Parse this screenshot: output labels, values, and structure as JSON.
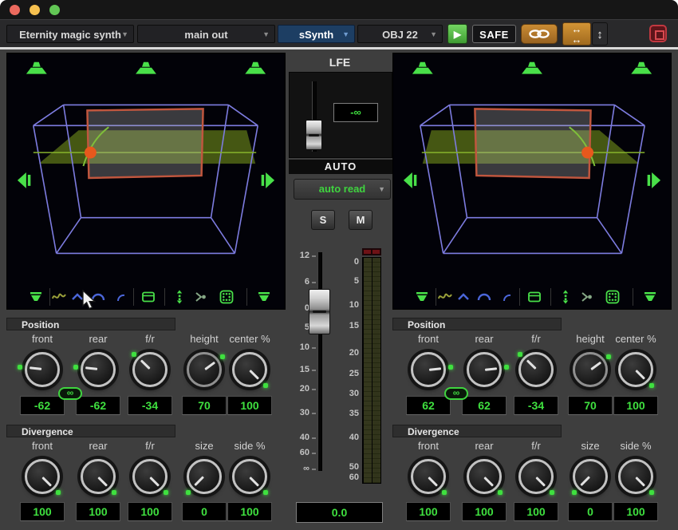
{
  "titlebar": {
    "lights": [
      "#ec6a5e",
      "#f5c04f",
      "#62c655"
    ]
  },
  "toolbar": {
    "instrument": "Eternity magic synth",
    "output": "main out",
    "plugin": "sSynth",
    "object": "OBJ 22",
    "safe": "SAFE",
    "icons": {
      "play": "▶",
      "width_horizontal": "↔",
      "width_vertical": "↕",
      "dropdown_arrow": "▼"
    },
    "colors": {
      "plugin_tab_bg": "#1d3e63",
      "link_button_bg": "#b5782a",
      "play_button_green": "#55c247",
      "target_button_red": "#c13840"
    }
  },
  "lfe": {
    "title": "LFE",
    "value": "-∞"
  },
  "auto": {
    "title": "AUTO",
    "mode": "auto read"
  },
  "monitor": {
    "solo": "S",
    "mute": "M"
  },
  "fader": {
    "scale": [
      "12",
      "6",
      "0",
      "5",
      "10",
      "15",
      "20",
      "30",
      "40",
      "60",
      "∞"
    ],
    "value": "0.0"
  },
  "meter": {
    "scale": [
      "0",
      "5",
      "10",
      "15",
      "20",
      "25",
      "30",
      "35",
      "40",
      "50",
      "60"
    ]
  },
  "view_icons": [
    "speaker",
    "wave",
    "caret",
    "arc",
    "curve",
    "lock-box",
    "expand-vertical",
    "merge",
    "grid",
    "speaker"
  ],
  "panels": [
    {
      "side": "left",
      "position": {
        "title": "Position",
        "linked": true,
        "knobs": [
          {
            "label": "front",
            "value": -62,
            "min": -100,
            "max": 100
          },
          {
            "label": "rear",
            "value": -62,
            "min": -100,
            "max": 100
          },
          {
            "label": "f/r",
            "value": -34,
            "min": -100,
            "max": 100
          },
          {
            "label": "height",
            "value": 70,
            "min": 0,
            "max": 100,
            "dim": true
          },
          {
            "label": "center %",
            "value": 100,
            "min": 0,
            "max": 100
          }
        ]
      },
      "divergence": {
        "title": "Divergence",
        "linked": false,
        "knobs": [
          {
            "label": "front",
            "value": 100,
            "min": 0,
            "max": 100
          },
          {
            "label": "rear",
            "value": 100,
            "min": 0,
            "max": 100
          },
          {
            "label": "f/r",
            "value": 100,
            "min": 0,
            "max": 100
          },
          {
            "label": "size",
            "value": 0,
            "min": 0,
            "max": 100
          },
          {
            "label": "side %",
            "value": 100,
            "min": 0,
            "max": 100
          }
        ]
      }
    },
    {
      "side": "right",
      "position": {
        "title": "Position",
        "linked": true,
        "knobs": [
          {
            "label": "front",
            "value": 62,
            "min": -100,
            "max": 100
          },
          {
            "label": "rear",
            "value": 62,
            "min": -100,
            "max": 100
          },
          {
            "label": "f/r",
            "value": -34,
            "min": -100,
            "max": 100
          },
          {
            "label": "height",
            "value": 70,
            "min": 0,
            "max": 100,
            "dim": true
          },
          {
            "label": "center %",
            "value": 100,
            "min": 0,
            "max": 100
          }
        ]
      },
      "divergence": {
        "title": "Divergence",
        "linked": false,
        "knobs": [
          {
            "label": "front",
            "value": 100,
            "min": 0,
            "max": 100
          },
          {
            "label": "rear",
            "value": 100,
            "min": 0,
            "max": 100
          },
          {
            "label": "f/r",
            "value": 100,
            "min": 0,
            "max": 100
          },
          {
            "label": "size",
            "value": 0,
            "min": 0,
            "max": 100
          },
          {
            "label": "side %",
            "value": 100,
            "min": 0,
            "max": 100
          }
        ]
      }
    }
  ],
  "scene_colors": {
    "wireframe": "#7d7ce0",
    "plane_green": "#7d9e1e",
    "panel_red": "#c0563e",
    "pan_dot_orange": "#e7581d",
    "speaker_green": "#49e049"
  }
}
